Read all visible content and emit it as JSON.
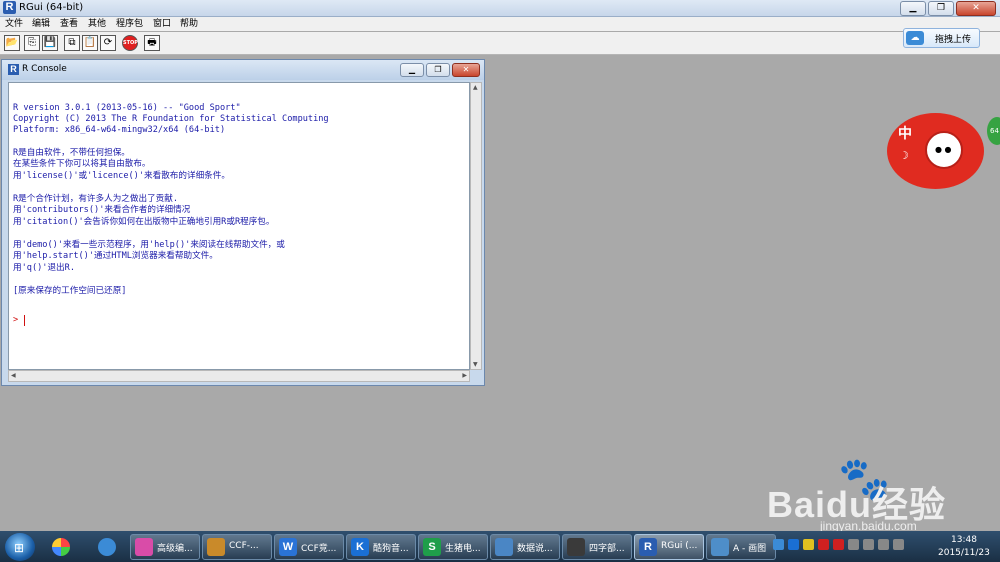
{
  "window": {
    "title": "RGui (64-bit)",
    "logo_letter": "R"
  },
  "menu": [
    "文件",
    "编辑",
    "查看",
    "其他",
    "程序包",
    "窗口",
    "帮助"
  ],
  "toolbar": {
    "stop_label": "STOP"
  },
  "upload_button": {
    "label": "拖拽上传"
  },
  "console": {
    "title": "R Console",
    "lines": [
      "R version 3.0.1 (2013-05-16) -- \"Good Sport\"",
      "Copyright (C) 2013 The R Foundation for Statistical Computing",
      "Platform: x86_64-w64-mingw32/x64 (64-bit)",
      "R是自由软件，不带任何担保。",
      "在某些条件下你可以将其自由散布。",
      "用'license()'或'licence()'来看散布的详细条件。",
      "R是个合作计划，有许多人为之做出了贡献.",
      "用'contributors()'来看合作者的详细情况",
      "用'citation()'会告诉你如何在出版物中正确地引用R或R程序包。",
      "用'demo()'来看一些示范程序，用'help()'来阅读在线帮助文件，或",
      "用'help.start()'通过HTML浏览器来看帮助文件。",
      "用'q()'退出R.",
      "[原来保存的工作空间已还原]"
    ],
    "prompt": ">"
  },
  "mascot": {
    "badge": "中",
    "side_badge": "64"
  },
  "watermark": {
    "brand": "Baidu经验",
    "url": "jingyan.baidu.com"
  },
  "taskbar": {
    "tasks": [
      {
        "label": "高级编...",
        "icon": "",
        "color": "#d94ca8"
      },
      {
        "label": "CCF-...",
        "icon": "",
        "color": "#c98a2a"
      },
      {
        "label": "CCF竞...",
        "icon": "W",
        "color": "#2a73d6"
      },
      {
        "label": "酷狗音...",
        "icon": "K",
        "color": "#1a6fd4"
      },
      {
        "label": "生猪电...",
        "icon": "S",
        "color": "#1f9e4a"
      },
      {
        "label": "数据说...",
        "icon": "",
        "color": "#4a86c5"
      },
      {
        "label": "四字部...",
        "icon": "",
        "color": "#3a3a3a"
      },
      {
        "label": "RGui (...",
        "icon": "R",
        "color": "#2a5db0"
      },
      {
        "label": "A - 画图",
        "icon": "",
        "color": "#4e8ec9"
      }
    ],
    "time": "13:48",
    "date": "2015/11/23"
  }
}
